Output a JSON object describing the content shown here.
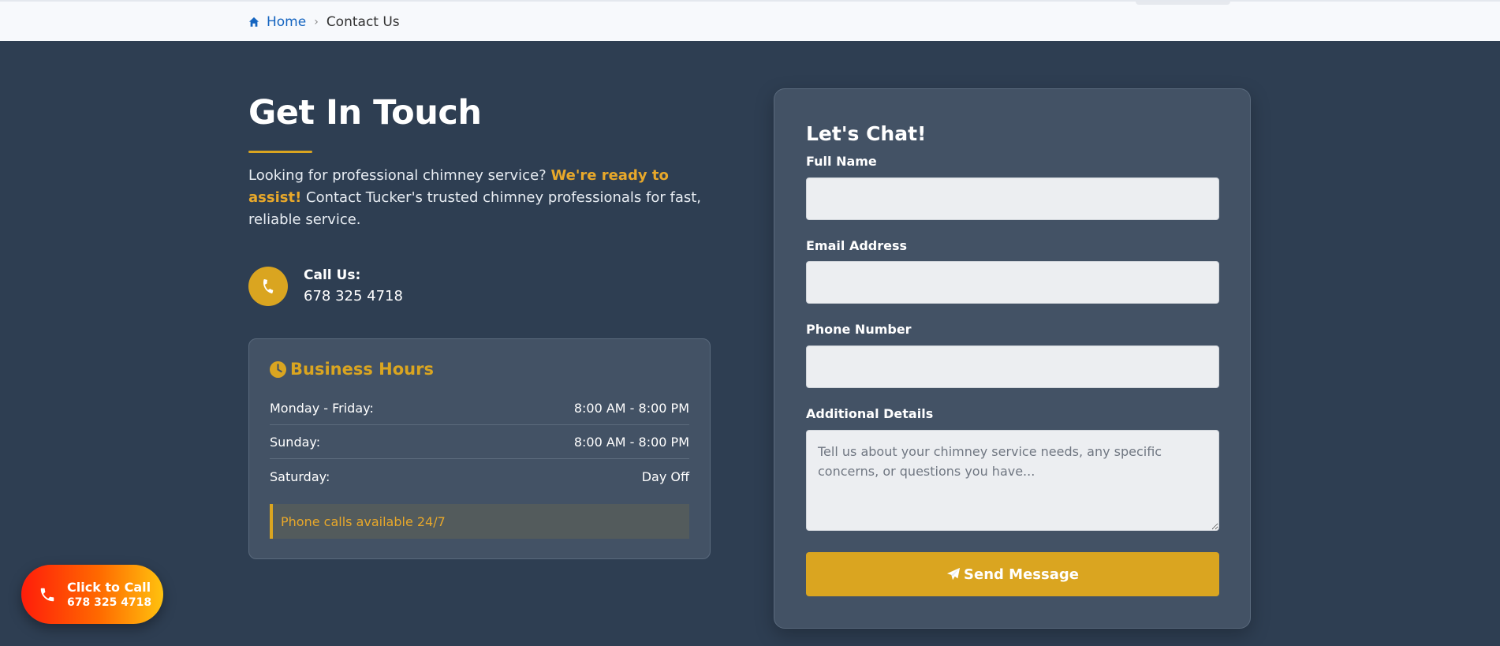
{
  "breadcrumb": {
    "home_label": "Home",
    "separator": "›",
    "current": "Contact Us"
  },
  "contact": {
    "title": "Get In Touch",
    "intro_lead": "Looking for professional chimney service? ",
    "intro_highlight": "We're ready to assist!",
    "intro_rest": " Contact Tucker's trusted chimney professionals for fast, reliable service.",
    "call_label": "Call Us:",
    "call_number": "678 325 4718"
  },
  "hours": {
    "title": "Business Hours",
    "rows": [
      {
        "day": "Monday - Friday:",
        "time": "8:00 AM - 8:00 PM"
      },
      {
        "day": "Sunday:",
        "time": "8:00 AM - 8:00 PM"
      },
      {
        "day": "Saturday:",
        "time": "Day Off"
      }
    ],
    "note": "Phone calls available 24/7"
  },
  "form": {
    "title": "Let's Chat!",
    "name_label": "Full Name",
    "name_value": "",
    "email_label": "Email Address",
    "email_value": "",
    "phone_label": "Phone Number",
    "phone_value": "",
    "details_label": "Additional Details",
    "details_placeholder": "Tell us about your chimney service needs, any specific concerns, or questions you have...",
    "submit_label": "Send Message"
  },
  "floating_call": {
    "label": "Click to Call",
    "number": "678 325 4718"
  },
  "colors": {
    "background": "#2e3e52",
    "card": "#435265",
    "accent": "#daa520",
    "link": "#1565c0"
  },
  "icons": {
    "breadcrumb_home": "home-icon",
    "call": "phone-icon",
    "hours": "clock-icon",
    "submit": "paper-plane-icon",
    "floating_call": "phone-icon"
  }
}
